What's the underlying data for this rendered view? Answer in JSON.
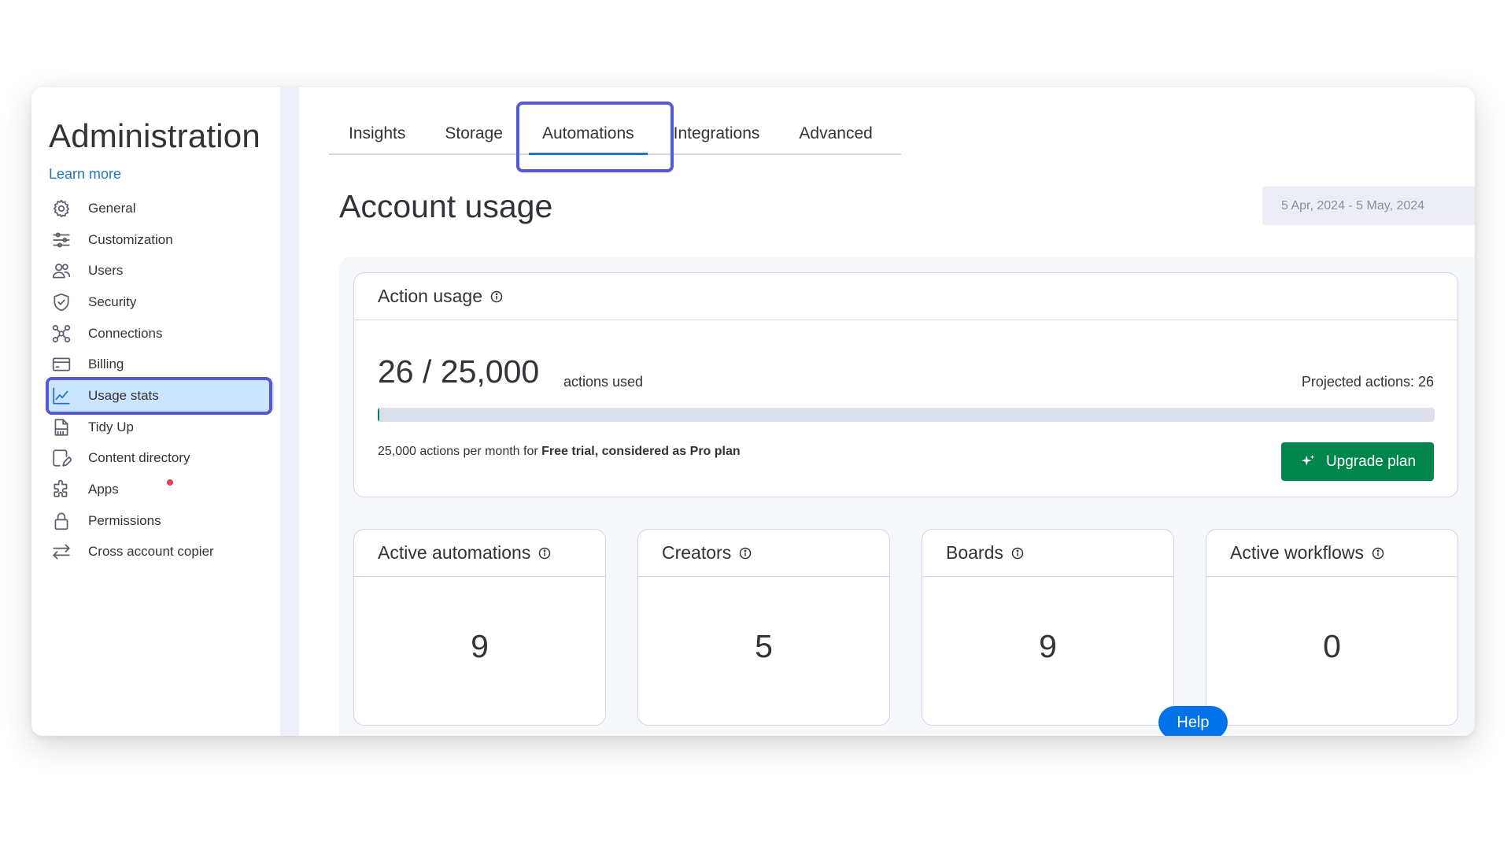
{
  "sidebar": {
    "title": "Administration",
    "learn_more": "Learn more",
    "items": [
      {
        "label": "General",
        "icon": "gear-icon"
      },
      {
        "label": "Customization",
        "icon": "sliders-icon"
      },
      {
        "label": "Users",
        "icon": "users-icon"
      },
      {
        "label": "Security",
        "icon": "shield-icon"
      },
      {
        "label": "Connections",
        "icon": "connections-icon"
      },
      {
        "label": "Billing",
        "icon": "credit-card-icon"
      },
      {
        "label": "Usage stats",
        "icon": "chart-line-icon",
        "active": true
      },
      {
        "label": "Tidy Up",
        "icon": "broom-icon"
      },
      {
        "label": "Content directory",
        "icon": "edit-document-icon"
      },
      {
        "label": "Apps",
        "icon": "puzzle-icon",
        "badge": "red-dot"
      },
      {
        "label": "Permissions",
        "icon": "lock-icon"
      },
      {
        "label": "Cross account copier",
        "icon": "arrows-swap-icon"
      }
    ]
  },
  "tabs": [
    {
      "label": "Insights"
    },
    {
      "label": "Storage"
    },
    {
      "label": "Automations",
      "active": true
    },
    {
      "label": "Integrations"
    },
    {
      "label": "Advanced"
    }
  ],
  "main": {
    "title": "Account usage",
    "date_range": "5 Apr, 2024 - 5 May, 2024"
  },
  "action_usage": {
    "title": "Action usage",
    "used_display": "26 / 25,000",
    "used_suffix": "actions used",
    "projected": "Projected actions: 26",
    "progress_fraction": 0.00104,
    "plan_note_prefix": "25,000 actions per month for ",
    "plan_note_bold": "Free trial, considered as Pro plan",
    "upgrade_label": "Upgrade plan"
  },
  "stats": [
    {
      "title": "Active automations",
      "value": "9"
    },
    {
      "title": "Creators",
      "value": "5"
    },
    {
      "title": "Boards",
      "value": "9"
    },
    {
      "title": "Active workflows",
      "value": "0"
    }
  ],
  "help_label": "Help",
  "colors": {
    "accent_blue": "#1f76c2",
    "highlight_outline": "#5558d6",
    "green": "#00854d",
    "help_blue": "#0073ea",
    "alert_red": "#e2445c"
  }
}
